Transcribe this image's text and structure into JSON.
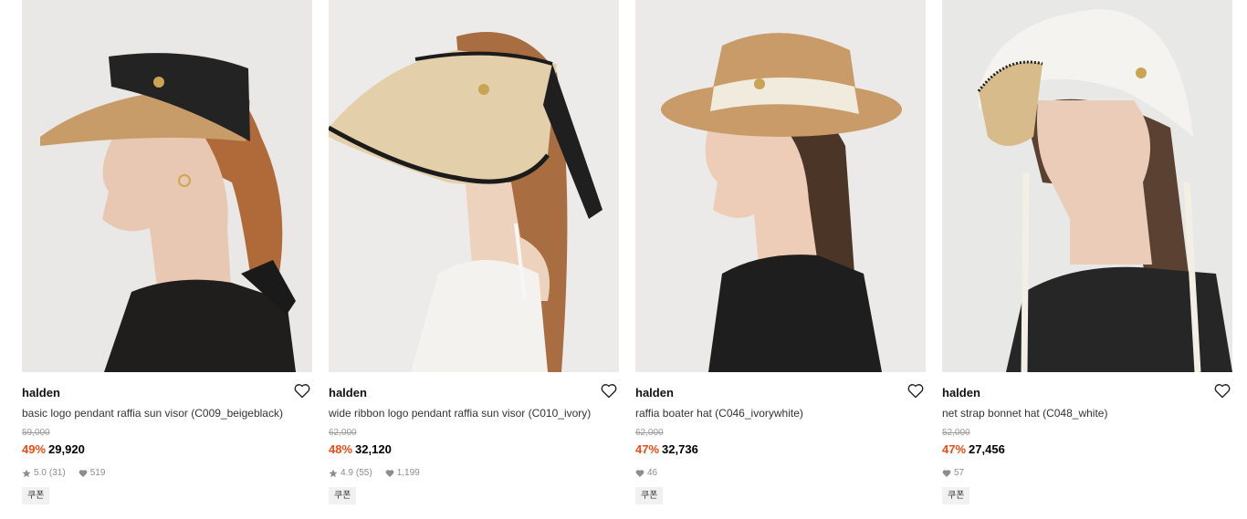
{
  "products": [
    {
      "brand": "halden",
      "name": "basic logo pendant raffia sun visor (C009_beigeblack)",
      "original_price": "59,000",
      "discount": "49%",
      "price": "29,920",
      "rating": "5.0",
      "review_count": "(31)",
      "likes": "519",
      "coupon": "쿠폰"
    },
    {
      "brand": "halden",
      "name": "wide ribbon logo pendant raffia sun visor (C010_ivory)",
      "original_price": "62,000",
      "discount": "48%",
      "price": "32,120",
      "rating": "4.9",
      "review_count": "(55)",
      "likes": "1,199",
      "coupon": "쿠폰"
    },
    {
      "brand": "halden",
      "name": "raffia boater hat (C046_ivorywhite)",
      "original_price": "62,000",
      "discount": "47%",
      "price": "32,736",
      "likes": "46",
      "coupon": "쿠폰"
    },
    {
      "brand": "halden",
      "name": "net strap bonnet hat (C048_white)",
      "original_price": "52,000",
      "discount": "47%",
      "price": "27,456",
      "likes": "57",
      "coupon": "쿠폰"
    }
  ],
  "colors": {
    "discount": "#ef4b12",
    "meta": "#8d8d8d",
    "coupon_bg": "#f1f1f1"
  }
}
